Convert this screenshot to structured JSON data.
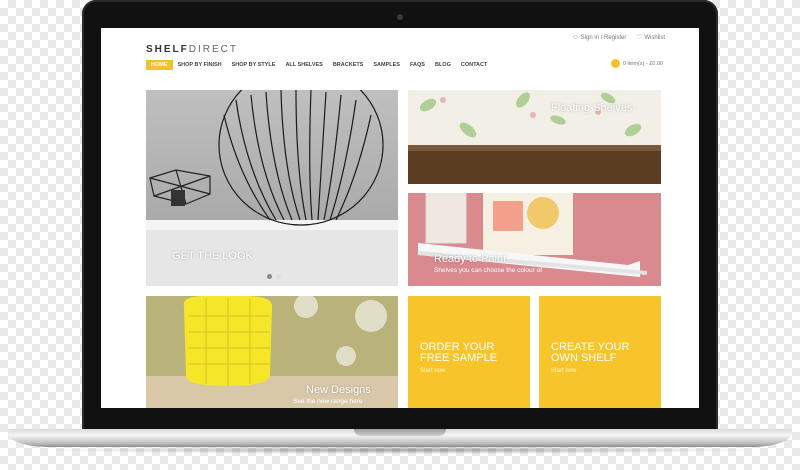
{
  "header": {
    "logo_bold": "SHELF",
    "logo_light": "DIRECT",
    "sign_in": "Sign in / Register",
    "wishlist": "Wishlist",
    "cart": "0 item(s) - £0.00"
  },
  "nav": {
    "items": [
      {
        "label": "HOME"
      },
      {
        "label": "SHOP BY FINISH"
      },
      {
        "label": "SHOP BY STYLE"
      },
      {
        "label": "ALL SHELVES"
      },
      {
        "label": "BRACKETS"
      },
      {
        "label": "SAMPLES"
      },
      {
        "label": "FAQS"
      },
      {
        "label": "BLOG"
      },
      {
        "label": "CONTACT"
      }
    ],
    "active_index": 0
  },
  "tiles": {
    "look": {
      "title": "GET THE LOOK"
    },
    "floating": {
      "title": "Floating Shelves"
    },
    "paint": {
      "title": "Ready to Paint",
      "subtitle": "Shelves you can choose the colour of"
    },
    "new_designs": {
      "title": "New Designs",
      "subtitle": "See the new range here"
    },
    "order": {
      "line1": "ORDER YOUR",
      "line2": "FREE SAMPLE",
      "subtitle": "Start now"
    },
    "create": {
      "line1": "CREATE YOUR",
      "line2": "OWN SHELF",
      "subtitle": "Start now"
    }
  },
  "colors": {
    "accent": "#f2c12e",
    "tile_yellow": "#f7c52b"
  },
  "icons": {
    "user": "user-icon",
    "wishlist": "heart-icon",
    "cart": "cart-icon"
  }
}
